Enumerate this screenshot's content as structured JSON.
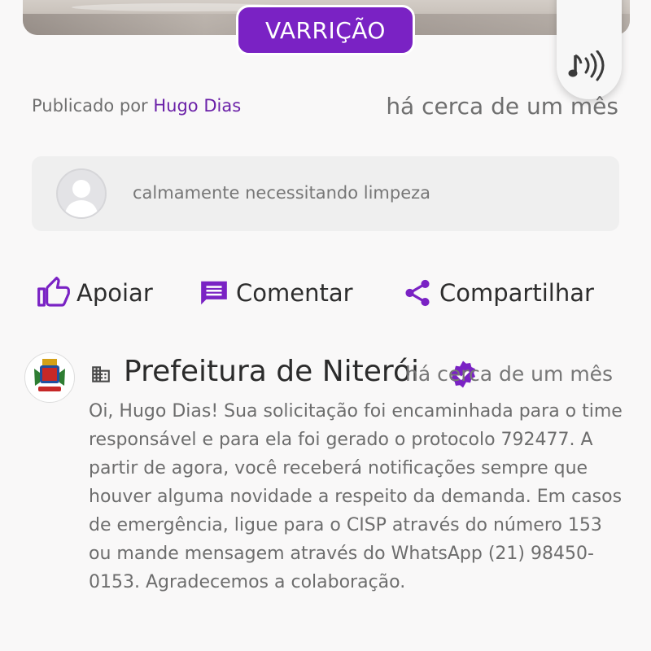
{
  "post": {
    "category": "VARRIÇÃO",
    "published_prefix": "Publicado por",
    "author": "Hugo Dias",
    "published_time": "há cerca de um mês",
    "description": "calmamente necessitando limpeza"
  },
  "audio": {
    "icon": "audio-note-icon"
  },
  "actions": [
    {
      "label": "Apoiar",
      "icon": "thumb-up-icon"
    },
    {
      "label": "Comentar",
      "icon": "comment-icon"
    },
    {
      "label": "Compartilhar",
      "icon": "share-icon"
    }
  ],
  "response": {
    "name": "Prefeitura de Niterói",
    "time": "há cerca de um mês",
    "message": "Oi, Hugo Dias! Sua solicitação foi encaminhada para o time responsável e para ela foi gerado o protocolo 792477. A partir de agora, você receberá notificações sempre que houver alguma novidade a respeito da demanda. Em casos de emergência, ligue para o CISP através do número 153 ou mande mensagem através do WhatsApp (21) 98450-0153. Agradecemos a colaboração."
  },
  "colors": {
    "accent": "#7a22c4",
    "author": "#6b21a8",
    "background": "#f9f8f8",
    "comment_bg": "#efefef"
  }
}
